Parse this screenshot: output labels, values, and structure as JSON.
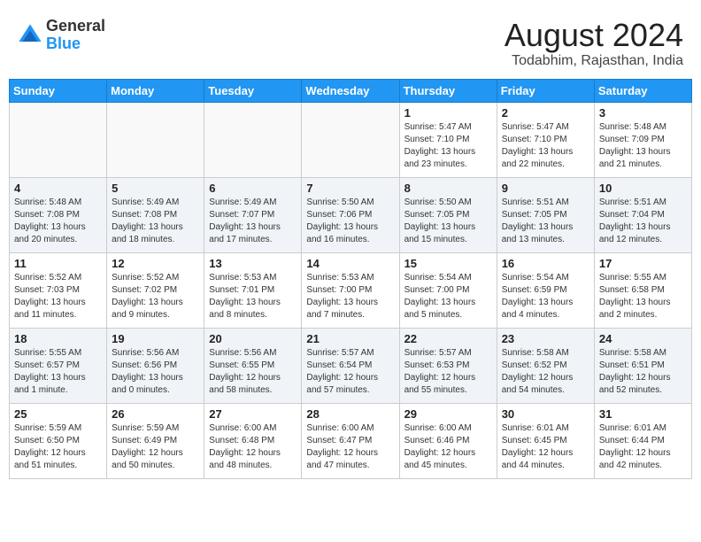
{
  "header": {
    "logo_general": "General",
    "logo_blue": "Blue",
    "month_year": "August 2024",
    "location": "Todabhim, Rajasthan, India"
  },
  "weekdays": [
    "Sunday",
    "Monday",
    "Tuesday",
    "Wednesday",
    "Thursday",
    "Friday",
    "Saturday"
  ],
  "weeks": [
    [
      {
        "day": "",
        "info": ""
      },
      {
        "day": "",
        "info": ""
      },
      {
        "day": "",
        "info": ""
      },
      {
        "day": "",
        "info": ""
      },
      {
        "day": "1",
        "info": "Sunrise: 5:47 AM\nSunset: 7:10 PM\nDaylight: 13 hours\nand 23 minutes."
      },
      {
        "day": "2",
        "info": "Sunrise: 5:47 AM\nSunset: 7:10 PM\nDaylight: 13 hours\nand 22 minutes."
      },
      {
        "day": "3",
        "info": "Sunrise: 5:48 AM\nSunset: 7:09 PM\nDaylight: 13 hours\nand 21 minutes."
      }
    ],
    [
      {
        "day": "4",
        "info": "Sunrise: 5:48 AM\nSunset: 7:08 PM\nDaylight: 13 hours\nand 20 minutes."
      },
      {
        "day": "5",
        "info": "Sunrise: 5:49 AM\nSunset: 7:08 PM\nDaylight: 13 hours\nand 18 minutes."
      },
      {
        "day": "6",
        "info": "Sunrise: 5:49 AM\nSunset: 7:07 PM\nDaylight: 13 hours\nand 17 minutes."
      },
      {
        "day": "7",
        "info": "Sunrise: 5:50 AM\nSunset: 7:06 PM\nDaylight: 13 hours\nand 16 minutes."
      },
      {
        "day": "8",
        "info": "Sunrise: 5:50 AM\nSunset: 7:05 PM\nDaylight: 13 hours\nand 15 minutes."
      },
      {
        "day": "9",
        "info": "Sunrise: 5:51 AM\nSunset: 7:05 PM\nDaylight: 13 hours\nand 13 minutes."
      },
      {
        "day": "10",
        "info": "Sunrise: 5:51 AM\nSunset: 7:04 PM\nDaylight: 13 hours\nand 12 minutes."
      }
    ],
    [
      {
        "day": "11",
        "info": "Sunrise: 5:52 AM\nSunset: 7:03 PM\nDaylight: 13 hours\nand 11 minutes."
      },
      {
        "day": "12",
        "info": "Sunrise: 5:52 AM\nSunset: 7:02 PM\nDaylight: 13 hours\nand 9 minutes."
      },
      {
        "day": "13",
        "info": "Sunrise: 5:53 AM\nSunset: 7:01 PM\nDaylight: 13 hours\nand 8 minutes."
      },
      {
        "day": "14",
        "info": "Sunrise: 5:53 AM\nSunset: 7:00 PM\nDaylight: 13 hours\nand 7 minutes."
      },
      {
        "day": "15",
        "info": "Sunrise: 5:54 AM\nSunset: 7:00 PM\nDaylight: 13 hours\nand 5 minutes."
      },
      {
        "day": "16",
        "info": "Sunrise: 5:54 AM\nSunset: 6:59 PM\nDaylight: 13 hours\nand 4 minutes."
      },
      {
        "day": "17",
        "info": "Sunrise: 5:55 AM\nSunset: 6:58 PM\nDaylight: 13 hours\nand 2 minutes."
      }
    ],
    [
      {
        "day": "18",
        "info": "Sunrise: 5:55 AM\nSunset: 6:57 PM\nDaylight: 13 hours\nand 1 minute."
      },
      {
        "day": "19",
        "info": "Sunrise: 5:56 AM\nSunset: 6:56 PM\nDaylight: 13 hours\nand 0 minutes."
      },
      {
        "day": "20",
        "info": "Sunrise: 5:56 AM\nSunset: 6:55 PM\nDaylight: 12 hours\nand 58 minutes."
      },
      {
        "day": "21",
        "info": "Sunrise: 5:57 AM\nSunset: 6:54 PM\nDaylight: 12 hours\nand 57 minutes."
      },
      {
        "day": "22",
        "info": "Sunrise: 5:57 AM\nSunset: 6:53 PM\nDaylight: 12 hours\nand 55 minutes."
      },
      {
        "day": "23",
        "info": "Sunrise: 5:58 AM\nSunset: 6:52 PM\nDaylight: 12 hours\nand 54 minutes."
      },
      {
        "day": "24",
        "info": "Sunrise: 5:58 AM\nSunset: 6:51 PM\nDaylight: 12 hours\nand 52 minutes."
      }
    ],
    [
      {
        "day": "25",
        "info": "Sunrise: 5:59 AM\nSunset: 6:50 PM\nDaylight: 12 hours\nand 51 minutes."
      },
      {
        "day": "26",
        "info": "Sunrise: 5:59 AM\nSunset: 6:49 PM\nDaylight: 12 hours\nand 50 minutes."
      },
      {
        "day": "27",
        "info": "Sunrise: 6:00 AM\nSunset: 6:48 PM\nDaylight: 12 hours\nand 48 minutes."
      },
      {
        "day": "28",
        "info": "Sunrise: 6:00 AM\nSunset: 6:47 PM\nDaylight: 12 hours\nand 47 minutes."
      },
      {
        "day": "29",
        "info": "Sunrise: 6:00 AM\nSunset: 6:46 PM\nDaylight: 12 hours\nand 45 minutes."
      },
      {
        "day": "30",
        "info": "Sunrise: 6:01 AM\nSunset: 6:45 PM\nDaylight: 12 hours\nand 44 minutes."
      },
      {
        "day": "31",
        "info": "Sunrise: 6:01 AM\nSunset: 6:44 PM\nDaylight: 12 hours\nand 42 minutes."
      }
    ]
  ]
}
